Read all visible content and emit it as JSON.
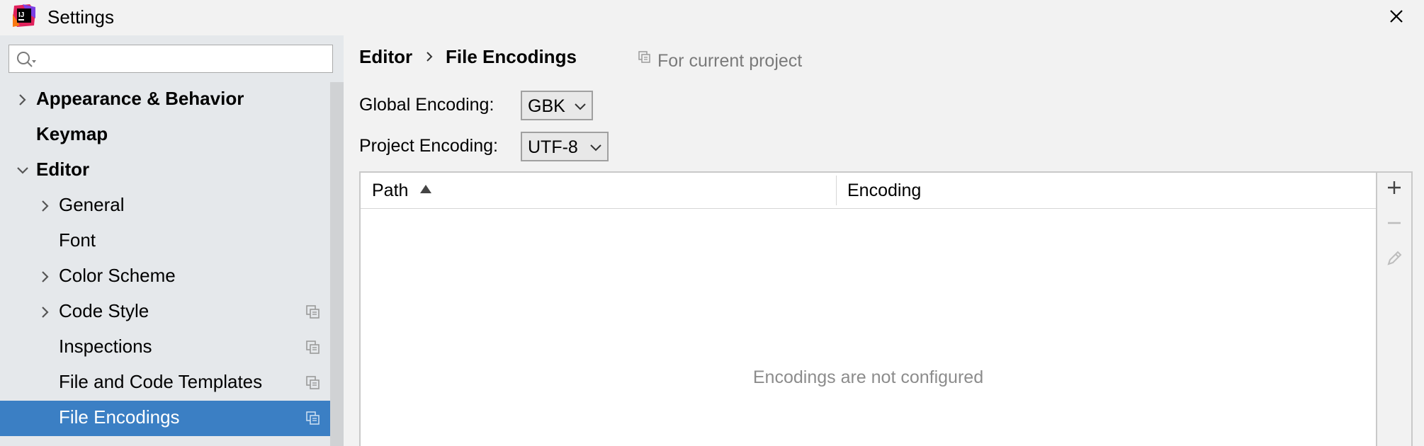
{
  "window": {
    "title": "Settings"
  },
  "sidebar": {
    "search_placeholder": "",
    "items": [
      {
        "label": "Appearance & Behavior"
      },
      {
        "label": "Keymap"
      },
      {
        "label": "Editor"
      },
      {
        "label": "General"
      },
      {
        "label": "Font"
      },
      {
        "label": "Color Scheme"
      },
      {
        "label": "Code Style"
      },
      {
        "label": "Inspections"
      },
      {
        "label": "File and Code Templates"
      },
      {
        "label": "File Encodings"
      }
    ]
  },
  "main": {
    "breadcrumb": {
      "parent": "Editor",
      "current": "File Encodings"
    },
    "scope_label": "For current project",
    "global_encoding": {
      "label": "Global Encoding:",
      "value": "GBK"
    },
    "project_encoding": {
      "label": "Project Encoding:",
      "value": "UTF-8"
    },
    "table": {
      "columns": [
        "Path",
        "Encoding"
      ],
      "sort_column": "Path",
      "sort_direction": "ascending",
      "empty_text": "Encodings are not configured"
    }
  },
  "colors": {
    "selection": "#3b7fc4",
    "sidebar_bg": "#e5e8eb",
    "window_bg": "#f2f2f2"
  }
}
